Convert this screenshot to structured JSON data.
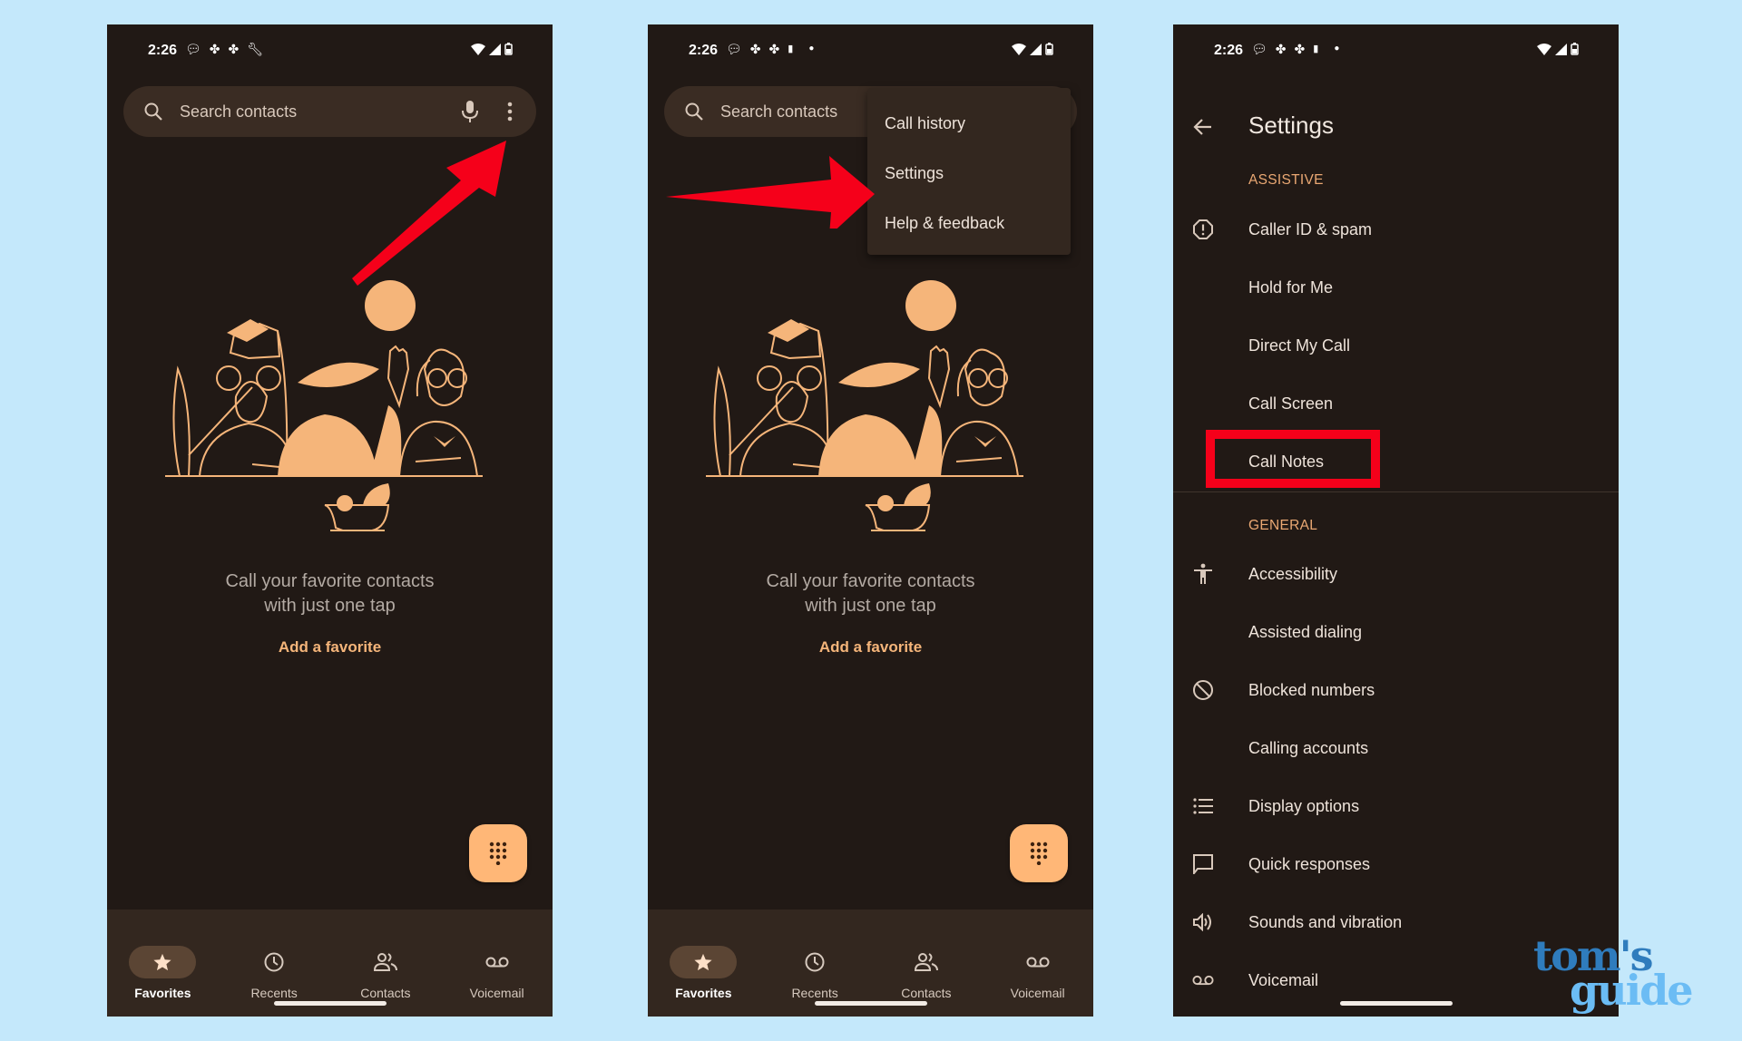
{
  "status_bar": {
    "time": "2:26"
  },
  "panel1": {
    "search": {
      "placeholder": "Search contacts"
    },
    "empty_state": {
      "line1": "Call your favorite contacts",
      "line2": "with just one tap",
      "action": "Add a favorite"
    },
    "bottom_nav": [
      {
        "label": "Favorites",
        "icon": "star-icon",
        "active": true
      },
      {
        "label": "Recents",
        "icon": "clock-icon",
        "active": false
      },
      {
        "label": "Contacts",
        "icon": "people-icon",
        "active": false
      },
      {
        "label": "Voicemail",
        "icon": "voicemail-icon",
        "active": false
      }
    ]
  },
  "panel2": {
    "search": {
      "placeholder": "Search contacts"
    },
    "overflow_menu": [
      {
        "label": "Call history"
      },
      {
        "label": "Settings"
      },
      {
        "label": "Help & feedback"
      }
    ],
    "empty_state": {
      "line1": "Call your favorite contacts",
      "line2": "with just one tap",
      "action": "Add a favorite"
    },
    "bottom_nav": [
      {
        "label": "Favorites",
        "icon": "star-icon",
        "active": true
      },
      {
        "label": "Recents",
        "icon": "clock-icon",
        "active": false
      },
      {
        "label": "Contacts",
        "icon": "people-icon",
        "active": false
      },
      {
        "label": "Voicemail",
        "icon": "voicemail-icon",
        "active": false
      }
    ]
  },
  "panel3": {
    "title": "Settings",
    "sections": [
      {
        "header": "ASSISTIVE",
        "items": [
          {
            "label": "Caller ID & spam",
            "icon": "alert-octagon-icon"
          },
          {
            "label": "Hold for Me",
            "icon": ""
          },
          {
            "label": "Direct My Call",
            "icon": ""
          },
          {
            "label": "Call Screen",
            "icon": ""
          },
          {
            "label": "Call Notes",
            "icon": "",
            "highlighted": true
          }
        ]
      },
      {
        "header": "GENERAL",
        "items": [
          {
            "label": "Accessibility",
            "icon": "accessibility-icon"
          },
          {
            "label": "Assisted dialing",
            "icon": ""
          },
          {
            "label": "Blocked numbers",
            "icon": "block-icon"
          },
          {
            "label": "Calling accounts",
            "icon": ""
          },
          {
            "label": "Display options",
            "icon": "list-icon"
          },
          {
            "label": "Quick responses",
            "icon": "chat-bubble-icon"
          },
          {
            "label": "Sounds and vibration",
            "icon": "speaker-icon"
          },
          {
            "label": "Voicemail",
            "icon": "voicemail-icon"
          }
        ]
      }
    ]
  },
  "watermark": {
    "line1": "tom's",
    "line2": "guide"
  },
  "colors": {
    "background": "#c4e8fb",
    "phone_bg": "#211915",
    "accent": "#ffb777",
    "annotation_red": "#f5001a"
  }
}
